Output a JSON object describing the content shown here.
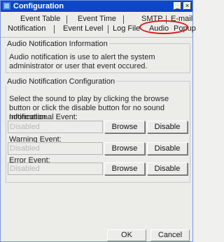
{
  "window": {
    "title": "Configuration",
    "minimize_icon": "_",
    "close_icon": "×"
  },
  "tabs": {
    "row1": [
      {
        "label": "Event Table"
      },
      {
        "label": "Event Time"
      },
      {
        "label": "SMTP"
      },
      {
        "label": "E-mail"
      }
    ],
    "row2": [
      {
        "label": "Notification"
      },
      {
        "label": "Event Level"
      },
      {
        "label": "Log File"
      },
      {
        "label": "Audio"
      },
      {
        "label": "Popup"
      }
    ],
    "active": "Audio"
  },
  "info_group": {
    "title": "Audio Notification Information",
    "text": "Audio notification is use to alert the system administrator or user that event occured."
  },
  "config_group": {
    "title": "Audio Notification Configuration",
    "instructions": "Select the sound to play by clicking the browse button or click the disable button for no sound notification.",
    "events": [
      {
        "label": "Informational Event:",
        "value": "Disabled",
        "browse": "Browse",
        "disable": "Disable"
      },
      {
        "label": "Warning Event:",
        "value": "Disabled",
        "browse": "Browse",
        "disable": "Disable"
      },
      {
        "label": "Error Event:",
        "value": "Disabled",
        "browse": "Browse",
        "disable": "Disable"
      }
    ]
  },
  "footer": {
    "ok": "OK",
    "cancel": "Cancel"
  },
  "colors": {
    "titlebar": "#0d46c8",
    "highlight": "#d91a1a"
  }
}
